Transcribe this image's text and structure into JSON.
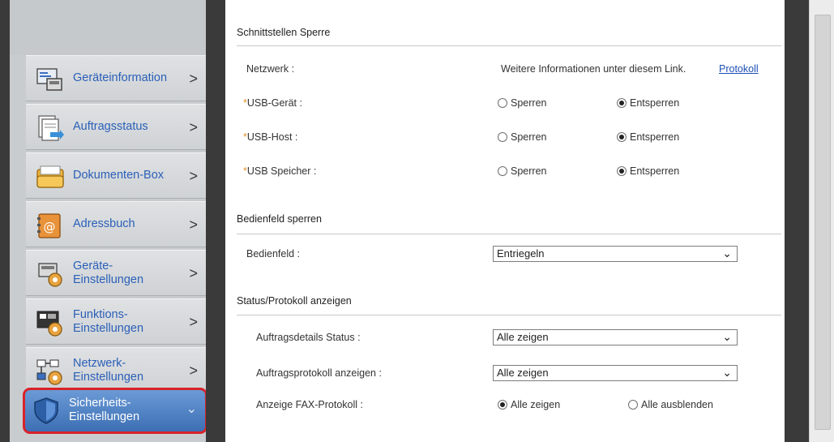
{
  "sidebar": {
    "items": [
      {
        "label": "Geräteinformation",
        "icon": "device-info-icon",
        "arrow": ">"
      },
      {
        "label": "Auftragsstatus",
        "icon": "job-status-icon",
        "arrow": ">"
      },
      {
        "label": "Dokumenten-Box",
        "icon": "document-box-icon",
        "arrow": ">"
      },
      {
        "label": "Adressbuch",
        "icon": "address-book-icon",
        "arrow": ">"
      },
      {
        "label_line1": "Geräte-",
        "label_line2": "Einstellungen",
        "icon": "device-settings-icon",
        "arrow": ">"
      },
      {
        "label_line1": "Funktions-",
        "label_line2": "Einstellungen",
        "icon": "function-settings-icon",
        "arrow": ">"
      },
      {
        "label_line1": "Netzwerk-",
        "label_line2": "Einstellungen",
        "icon": "network-settings-icon",
        "arrow": ">"
      },
      {
        "label_line1": "Sicherheits-",
        "label_line2": "Einstellungen",
        "icon": "security-shield-icon",
        "arrow": "⌄",
        "active": true
      }
    ]
  },
  "interface_lock": {
    "title": "Schnittstellen Sperre",
    "network": {
      "label": "Netzwerk :",
      "info": "Weitere Informationen unter diesem Link.",
      "link": "Protokoll"
    },
    "rows": [
      {
        "label": "USB-Gerät :",
        "options": [
          "Sperren",
          "Entsperren"
        ],
        "selected": "Entsperren"
      },
      {
        "label": "USB-Host :",
        "options": [
          "Sperren",
          "Entsperren"
        ],
        "selected": "Entsperren"
      },
      {
        "label": "USB Speicher :",
        "options": [
          "Sperren",
          "Entsperren"
        ],
        "selected": "Entsperren"
      }
    ],
    "required_mark": "*"
  },
  "panel_lock": {
    "title": "Bedienfeld sperren",
    "label": "Bedienfeld :",
    "value": "Entriegeln"
  },
  "status_log": {
    "title": "Status/Protokoll anzeigen",
    "job_details": {
      "label": "Auftragsdetails Status :",
      "value": "Alle zeigen"
    },
    "job_log": {
      "label": "Auftragsprotokoll anzeigen :",
      "value": "Alle zeigen"
    },
    "fax_log": {
      "label": "Anzeige FAX-Protokoll :",
      "options": [
        "Alle zeigen",
        "Alle ausblenden"
      ],
      "selected": "Alle zeigen"
    }
  },
  "colors": {
    "link": "#1d4fb4",
    "required": "#e3932a",
    "active_border": "#d8232a",
    "nav_text": "#2a5fb8"
  }
}
